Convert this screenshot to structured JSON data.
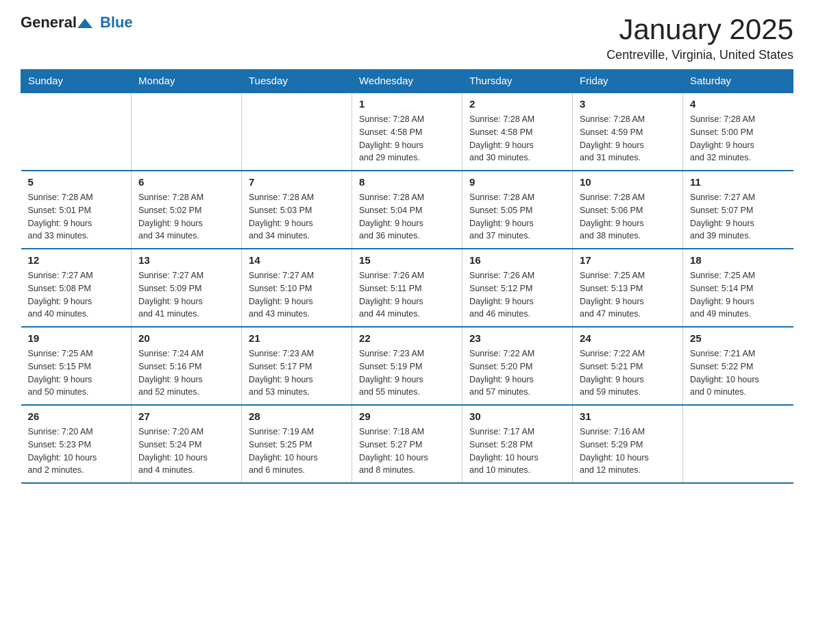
{
  "logo": {
    "general": "General",
    "blue": "Blue"
  },
  "title": "January 2025",
  "subtitle": "Centreville, Virginia, United States",
  "days_of_week": [
    "Sunday",
    "Monday",
    "Tuesday",
    "Wednesday",
    "Thursday",
    "Friday",
    "Saturday"
  ],
  "weeks": [
    [
      {
        "day": "",
        "info": ""
      },
      {
        "day": "",
        "info": ""
      },
      {
        "day": "",
        "info": ""
      },
      {
        "day": "1",
        "info": "Sunrise: 7:28 AM\nSunset: 4:58 PM\nDaylight: 9 hours\nand 29 minutes."
      },
      {
        "day": "2",
        "info": "Sunrise: 7:28 AM\nSunset: 4:58 PM\nDaylight: 9 hours\nand 30 minutes."
      },
      {
        "day": "3",
        "info": "Sunrise: 7:28 AM\nSunset: 4:59 PM\nDaylight: 9 hours\nand 31 minutes."
      },
      {
        "day": "4",
        "info": "Sunrise: 7:28 AM\nSunset: 5:00 PM\nDaylight: 9 hours\nand 32 minutes."
      }
    ],
    [
      {
        "day": "5",
        "info": "Sunrise: 7:28 AM\nSunset: 5:01 PM\nDaylight: 9 hours\nand 33 minutes."
      },
      {
        "day": "6",
        "info": "Sunrise: 7:28 AM\nSunset: 5:02 PM\nDaylight: 9 hours\nand 34 minutes."
      },
      {
        "day": "7",
        "info": "Sunrise: 7:28 AM\nSunset: 5:03 PM\nDaylight: 9 hours\nand 34 minutes."
      },
      {
        "day": "8",
        "info": "Sunrise: 7:28 AM\nSunset: 5:04 PM\nDaylight: 9 hours\nand 36 minutes."
      },
      {
        "day": "9",
        "info": "Sunrise: 7:28 AM\nSunset: 5:05 PM\nDaylight: 9 hours\nand 37 minutes."
      },
      {
        "day": "10",
        "info": "Sunrise: 7:28 AM\nSunset: 5:06 PM\nDaylight: 9 hours\nand 38 minutes."
      },
      {
        "day": "11",
        "info": "Sunrise: 7:27 AM\nSunset: 5:07 PM\nDaylight: 9 hours\nand 39 minutes."
      }
    ],
    [
      {
        "day": "12",
        "info": "Sunrise: 7:27 AM\nSunset: 5:08 PM\nDaylight: 9 hours\nand 40 minutes."
      },
      {
        "day": "13",
        "info": "Sunrise: 7:27 AM\nSunset: 5:09 PM\nDaylight: 9 hours\nand 41 minutes."
      },
      {
        "day": "14",
        "info": "Sunrise: 7:27 AM\nSunset: 5:10 PM\nDaylight: 9 hours\nand 43 minutes."
      },
      {
        "day": "15",
        "info": "Sunrise: 7:26 AM\nSunset: 5:11 PM\nDaylight: 9 hours\nand 44 minutes."
      },
      {
        "day": "16",
        "info": "Sunrise: 7:26 AM\nSunset: 5:12 PM\nDaylight: 9 hours\nand 46 minutes."
      },
      {
        "day": "17",
        "info": "Sunrise: 7:25 AM\nSunset: 5:13 PM\nDaylight: 9 hours\nand 47 minutes."
      },
      {
        "day": "18",
        "info": "Sunrise: 7:25 AM\nSunset: 5:14 PM\nDaylight: 9 hours\nand 49 minutes."
      }
    ],
    [
      {
        "day": "19",
        "info": "Sunrise: 7:25 AM\nSunset: 5:15 PM\nDaylight: 9 hours\nand 50 minutes."
      },
      {
        "day": "20",
        "info": "Sunrise: 7:24 AM\nSunset: 5:16 PM\nDaylight: 9 hours\nand 52 minutes."
      },
      {
        "day": "21",
        "info": "Sunrise: 7:23 AM\nSunset: 5:17 PM\nDaylight: 9 hours\nand 53 minutes."
      },
      {
        "day": "22",
        "info": "Sunrise: 7:23 AM\nSunset: 5:19 PM\nDaylight: 9 hours\nand 55 minutes."
      },
      {
        "day": "23",
        "info": "Sunrise: 7:22 AM\nSunset: 5:20 PM\nDaylight: 9 hours\nand 57 minutes."
      },
      {
        "day": "24",
        "info": "Sunrise: 7:22 AM\nSunset: 5:21 PM\nDaylight: 9 hours\nand 59 minutes."
      },
      {
        "day": "25",
        "info": "Sunrise: 7:21 AM\nSunset: 5:22 PM\nDaylight: 10 hours\nand 0 minutes."
      }
    ],
    [
      {
        "day": "26",
        "info": "Sunrise: 7:20 AM\nSunset: 5:23 PM\nDaylight: 10 hours\nand 2 minutes."
      },
      {
        "day": "27",
        "info": "Sunrise: 7:20 AM\nSunset: 5:24 PM\nDaylight: 10 hours\nand 4 minutes."
      },
      {
        "day": "28",
        "info": "Sunrise: 7:19 AM\nSunset: 5:25 PM\nDaylight: 10 hours\nand 6 minutes."
      },
      {
        "day": "29",
        "info": "Sunrise: 7:18 AM\nSunset: 5:27 PM\nDaylight: 10 hours\nand 8 minutes."
      },
      {
        "day": "30",
        "info": "Sunrise: 7:17 AM\nSunset: 5:28 PM\nDaylight: 10 hours\nand 10 minutes."
      },
      {
        "day": "31",
        "info": "Sunrise: 7:16 AM\nSunset: 5:29 PM\nDaylight: 10 hours\nand 12 minutes."
      },
      {
        "day": "",
        "info": ""
      }
    ]
  ]
}
